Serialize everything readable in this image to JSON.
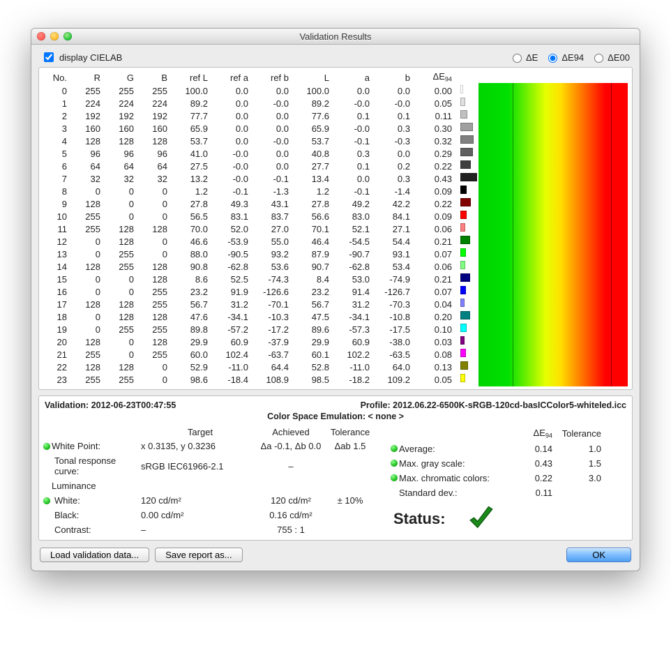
{
  "window_title": "Validation Results",
  "checkbox_label": "display CIELAB",
  "radios": {
    "de": "ΔE",
    "de94": "ΔE94",
    "de00": "ΔE00",
    "selected": "de94"
  },
  "headers": [
    "No.",
    "R",
    "G",
    "B",
    "ref L",
    "ref a",
    "ref b",
    "L",
    "a",
    "b",
    "ΔE₉₄"
  ],
  "rows": [
    {
      "no": 0,
      "r": 255,
      "g": 255,
      "b": "0.0",
      "rL": "100.0",
      "ra": "0.0",
      "rb": "0.0",
      "L": "100.0",
      "a": "0.0",
      "de": "0.00",
      "color": "#ffffff",
      "bar": 0
    },
    {
      "no": 1,
      "r": 224,
      "g": 224,
      "b": "-0.0",
      "rL": "89.2",
      "ra": "0.0",
      "rb": "-0.0",
      "L": "89.2",
      "a": "-0.0",
      "de": "0.05",
      "color": "#e0e0e0",
      "bar": 3
    },
    {
      "no": 2,
      "r": 192,
      "g": 192,
      "b": "0.1",
      "rL": "77.7",
      "ra": "0.0",
      "rb": "0.0",
      "L": "77.6",
      "a": "0.1",
      "de": "0.11",
      "color": "#c0c0c0",
      "bar": 6
    },
    {
      "no": 3,
      "r": 160,
      "g": 160,
      "b": "0.3",
      "rL": "65.9",
      "ra": "0.0",
      "rb": "0.0",
      "L": "65.9",
      "a": "-0.0",
      "de": "0.30",
      "color": "#a0a0a0",
      "bar": 14
    },
    {
      "no": 4,
      "r": 128,
      "g": 128,
      "b": "-0.3",
      "rL": "53.7",
      "ra": "0.0",
      "rb": "-0.0",
      "L": "53.7",
      "a": "-0.1",
      "de": "0.32",
      "color": "#808080",
      "bar": 15
    },
    {
      "no": 5,
      "r": 96,
      "g": 96,
      "b": "0.0",
      "rL": "41.0",
      "ra": "-0.0",
      "rb": "0.0",
      "L": "40.8",
      "a": "0.3",
      "de": "0.29",
      "color": "#606060",
      "bar": 14
    },
    {
      "no": 6,
      "r": 64,
      "g": 64,
      "b": "0.2",
      "rL": "27.5",
      "ra": "-0.0",
      "rb": "0.0",
      "L": "27.7",
      "a": "0.1",
      "de": "0.22",
      "color": "#404040",
      "bar": 11
    },
    {
      "no": 7,
      "r": 32,
      "g": 32,
      "b": "0.3",
      "rL": "13.2",
      "ra": "-0.0",
      "rb": "-0.1",
      "L": "13.4",
      "a": "0.0",
      "de": "0.43",
      "color": "#202020",
      "bar": 20
    },
    {
      "no": 8,
      "r": 0,
      "g": 0,
      "b": "-1.4",
      "rL": "1.2",
      "ra": "-0.1",
      "rb": "-1.3",
      "L": "1.2",
      "a": "-0.1",
      "de": "0.09",
      "color": "#000000",
      "bar": 5
    },
    {
      "no": 9,
      "r": 128,
      "g": 0,
      "b": "42.2",
      "rL": "27.8",
      "ra": "49.3",
      "rb": "43.1",
      "L": "27.8",
      "a": "49.2",
      "de": "0.22",
      "color": "#800000",
      "bar": 11
    },
    {
      "no": 10,
      "r": 255,
      "g": 0,
      "b": "84.1",
      "rL": "56.5",
      "ra": "83.1",
      "rb": "83.7",
      "L": "56.6",
      "a": "83.0",
      "de": "0.09",
      "color": "#ff0000",
      "bar": 5
    },
    {
      "no": 11,
      "r": 255,
      "g": 128,
      "b": "27.1",
      "rL": "70.0",
      "ra": "52.0",
      "rb": "27.0",
      "L": "70.1",
      "a": "52.1",
      "de": "0.06",
      "color": "#ff8080",
      "bar": 3
    },
    {
      "no": 12,
      "r": 0,
      "g": 128,
      "b": "54.4",
      "rL": "46.6",
      "ra": "-53.9",
      "rb": "55.0",
      "L": "46.4",
      "a": "-54.5",
      "de": "0.21",
      "color": "#008000",
      "bar": 10
    },
    {
      "no": 13,
      "r": 0,
      "g": 255,
      "b": "93.1",
      "rL": "88.0",
      "ra": "-90.5",
      "rb": "93.2",
      "L": "87.9",
      "a": "-90.7",
      "de": "0.07",
      "color": "#00ff00",
      "bar": 4
    },
    {
      "no": 14,
      "r": 128,
      "g": 255,
      "b": "53.4",
      "rL": "90.8",
      "ra": "-62.8",
      "rb": "53.6",
      "L": "90.7",
      "a": "-62.8",
      "de": "0.06",
      "color": "#80ff80",
      "bar": 3
    },
    {
      "no": 15,
      "r": 0,
      "g": 0,
      "b": "-74.9",
      "rL": "8.6",
      "ra": "52.5",
      "rb": "-74.3",
      "L": "8.4",
      "a": "53.0",
      "de": "0.21",
      "color": "#000080",
      "bar": 10
    },
    {
      "no": 16,
      "r": 0,
      "g": 0,
      "b": "-126.7",
      "rL": "23.2",
      "ra": "91.9",
      "rb": "-126.6",
      "L": "23.2",
      "a": "91.4",
      "de": "0.07",
      "color": "#0000ff",
      "bar": 4
    },
    {
      "no": 17,
      "r": 128,
      "g": 128,
      "b": "-70.3",
      "rL": "56.7",
      "ra": "31.2",
      "rb": "-70.1",
      "L": "56.7",
      "a": "31.2",
      "de": "0.04",
      "color": "#8080ff",
      "bar": 2
    },
    {
      "no": 18,
      "r": 0,
      "g": 128,
      "b": "-10.8",
      "rL": "47.6",
      "ra": "-34.1",
      "rb": "-10.3",
      "L": "47.5",
      "a": "-34.1",
      "de": "0.20",
      "color": "#008080",
      "bar": 10
    },
    {
      "no": 19,
      "r": 0,
      "g": 255,
      "b": "-17.5",
      "rL": "89.8",
      "ra": "-57.2",
      "rb": "-17.2",
      "L": "89.6",
      "a": "-57.3",
      "de": "0.10",
      "color": "#00ffff",
      "bar": 5
    },
    {
      "no": 20,
      "r": 128,
      "g": 0,
      "b": "-38.0",
      "rL": "29.9",
      "ra": "60.9",
      "rb": "-37.9",
      "L": "29.9",
      "a": "60.9",
      "de": "0.03",
      "color": "#800080",
      "bar": 2
    },
    {
      "no": 21,
      "r": 255,
      "g": 0,
      "b": "-63.5",
      "rL": "60.0",
      "ra": "102.4",
      "rb": "-63.7",
      "L": "60.1",
      "a": "102.2",
      "de": "0.08",
      "color": "#ff00ff",
      "bar": 4
    },
    {
      "no": 22,
      "r": 128,
      "g": 128,
      "b": "64.0",
      "rL": "52.9",
      "ra": "-11.0",
      "rb": "64.4",
      "L": "52.8",
      "a": "-11.0",
      "de": "0.13",
      "color": "#808000",
      "bar": 7
    },
    {
      "no": 23,
      "r": 255,
      "g": 255,
      "b": "109.2",
      "rL": "98.6",
      "ra": "-18.4",
      "rb": "108.9",
      "L": "98.5",
      "a": "-18.2",
      "de": "0.05",
      "color": "#ffff00",
      "bar": 3
    }
  ],
  "validation_label": "Validation: ",
  "validation_ts": "2012-06-23T00:47:55",
  "profile_label": "Profile: ",
  "profile_name": "2012.06.22-6500K-sRGB-120cd-basICColor5-whiteled.icc",
  "cse_label": "Color Space Emulation: ",
  "cse_value": "< none >",
  "left_head": {
    "c1": "",
    "c2": "Target",
    "c3": "Achieved",
    "c4": "Tolerance"
  },
  "leftrows": {
    "wp": {
      "label": "White Point:",
      "target": "x 0.3135, y 0.3236",
      "ach": "Δa -0.1, Δb 0.0",
      "tol": "Δab 1.5",
      "led": true
    },
    "trc": {
      "label": "Tonal response curve:",
      "target": "sRGB IEC61966-2.1",
      "ach": "–",
      "tol": "",
      "led": false
    },
    "lum": {
      "label": "Luminance",
      "target": "",
      "ach": "",
      "tol": "",
      "led": false
    },
    "white": {
      "label": "White:",
      "target": "120 cd/m²",
      "ach": "120 cd/m²",
      "tol": "± 10%",
      "led": true
    },
    "black": {
      "label": "Black:",
      "target": "0.00 cd/m²",
      "ach": "0.16 cd/m²",
      "tol": "",
      "led": false
    },
    "contr": {
      "label": "Contrast:",
      "target": "–",
      "ach": "755 : 1",
      "tol": "",
      "led": false
    }
  },
  "right_head": {
    "c1": "",
    "c2": "ΔE₉₄",
    "c3": "Tolerance"
  },
  "rightrows": {
    "avg": {
      "label": "Average:",
      "val": "0.14",
      "tol": "1.0",
      "led": true
    },
    "gray": {
      "label": "Max. gray scale:",
      "val": "0.43",
      "tol": "1.5",
      "led": true
    },
    "chr": {
      "label": "Max. chromatic colors:",
      "val": "0.22",
      "tol": "3.0",
      "led": true
    },
    "std": {
      "label": "Standard dev.:",
      "val": "0.11",
      "tol": "",
      "led": false
    }
  },
  "status_label": "Status:",
  "btn_load": "Load validation data...",
  "btn_save": "Save report as...",
  "btn_ok": "OK"
}
